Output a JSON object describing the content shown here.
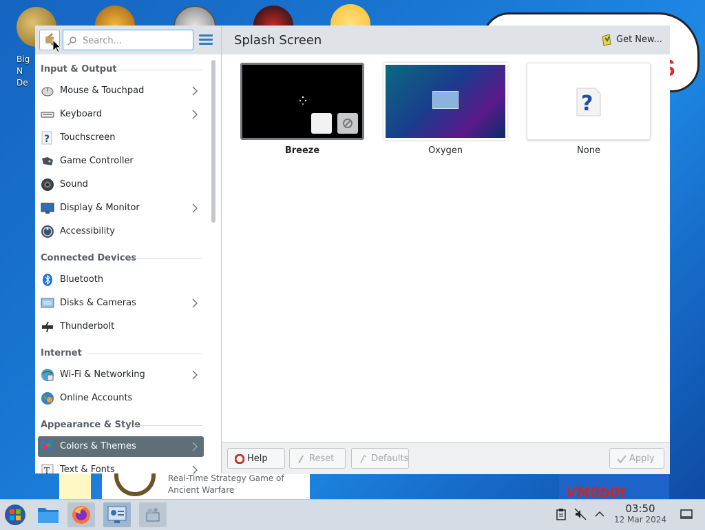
{
  "desktop": {
    "icon_label_partial": "Big N De",
    "strip_text": "Real-Time Strategy Game of Ancient Warfare",
    "vmo_text": "VM0b0t",
    "red_letter": "S"
  },
  "sidebar": {
    "search_placeholder": "Search...",
    "categories": [
      {
        "title": "Input & Output",
        "items": [
          {
            "label": "Mouse & Touchpad",
            "icon": "mouse-icon",
            "has_children": true
          },
          {
            "label": "Keyboard",
            "icon": "keyboard-icon",
            "has_children": true
          },
          {
            "label": "Touchscreen",
            "icon": "question-icon",
            "has_children": false
          },
          {
            "label": "Game Controller",
            "icon": "gamepad-icon",
            "has_children": false
          },
          {
            "label": "Sound",
            "icon": "speaker-icon",
            "has_children": false
          },
          {
            "label": "Display & Monitor",
            "icon": "monitor-icon",
            "has_children": true
          },
          {
            "label": "Accessibility",
            "icon": "accessibility-icon",
            "has_children": false
          }
        ]
      },
      {
        "title": "Connected Devices",
        "items": [
          {
            "label": "Bluetooth",
            "icon": "bluetooth-icon",
            "has_children": false
          },
          {
            "label": "Disks & Cameras",
            "icon": "disks-icon",
            "has_children": true
          },
          {
            "label": "Thunderbolt",
            "icon": "thunderbolt-icon",
            "has_children": false
          }
        ]
      },
      {
        "title": "Internet",
        "items": [
          {
            "label": "Wi-Fi & Networking",
            "icon": "network-icon",
            "has_children": true
          },
          {
            "label": "Online Accounts",
            "icon": "online-accounts-icon",
            "has_children": false
          }
        ]
      },
      {
        "title": "Appearance & Style",
        "items": [
          {
            "label": "Colors & Themes",
            "icon": "colors-icon",
            "has_children": true,
            "active": true
          },
          {
            "label": "Text & Fonts",
            "icon": "fonts-icon",
            "has_children": true
          }
        ]
      }
    ]
  },
  "content": {
    "title": "Splash Screen",
    "get_new_label": "Get New...",
    "themes": [
      {
        "label": "Breeze",
        "selected": true
      },
      {
        "label": "Oxygen",
        "selected": false
      },
      {
        "label": "None",
        "selected": false
      }
    ]
  },
  "footer": {
    "help_label": "Help",
    "reset_label": "Reset",
    "defaults_label": "Defaults",
    "apply_label": "Apply"
  },
  "taskbar": {
    "time": "03:50",
    "date": "12 Mar 2024"
  },
  "colors": {
    "accent": "#3daee9",
    "active_item": "#5e6f78",
    "desktop": "#1976d2"
  }
}
